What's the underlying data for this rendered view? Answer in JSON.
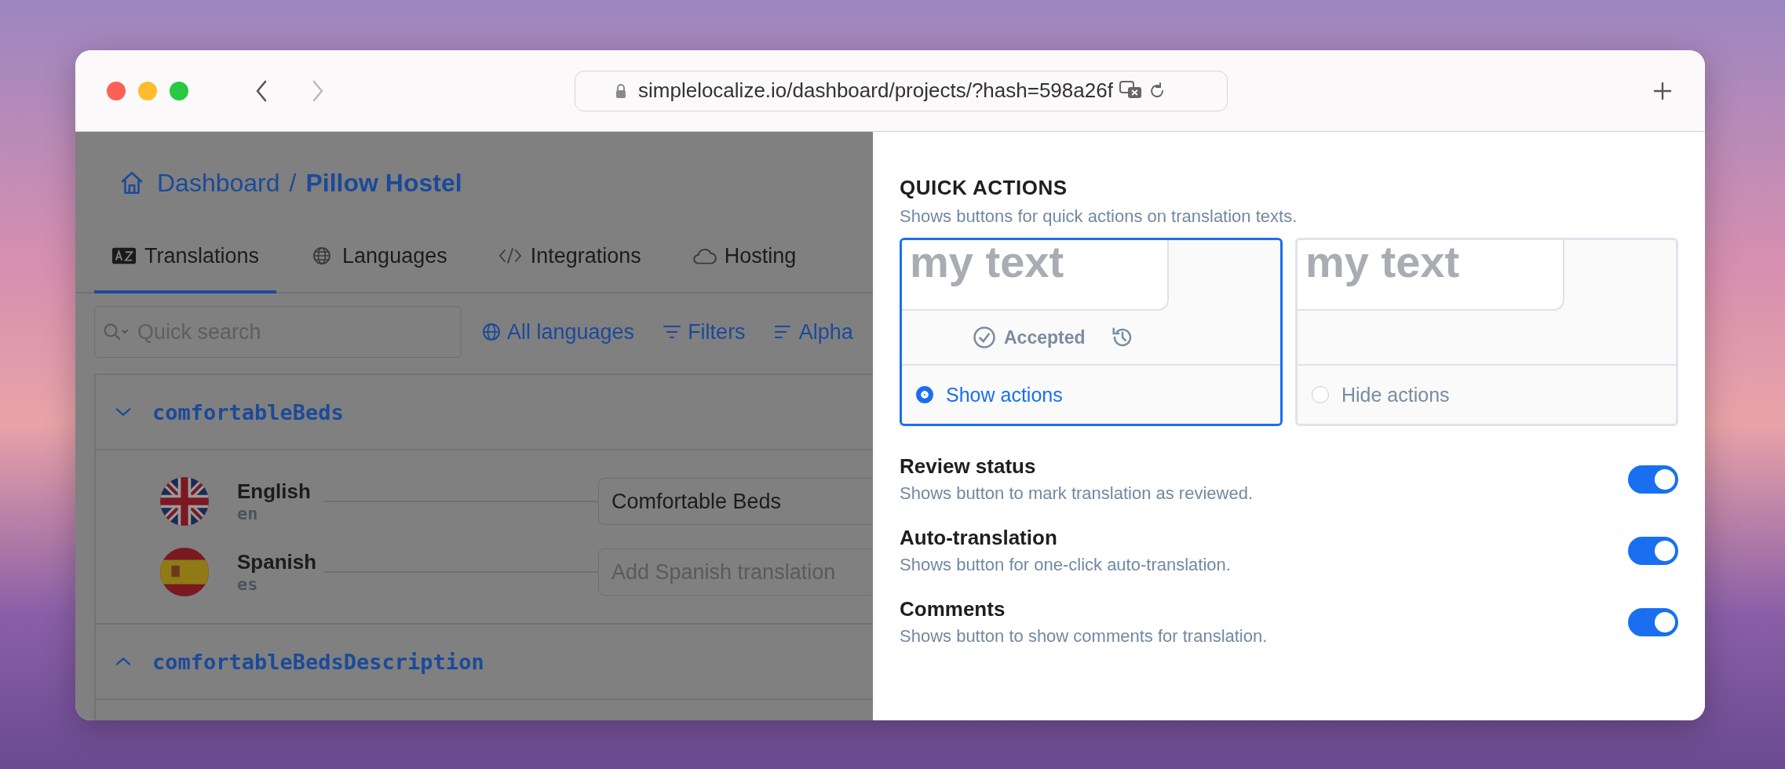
{
  "browser": {
    "url": "simplelocalize.io/dashboard/projects/?hash=598a26f"
  },
  "breadcrumb": {
    "parent": "Dashboard",
    "separator": "/",
    "current": "Pillow Hostel"
  },
  "tabs": [
    {
      "label": "Translations",
      "selected": true
    },
    {
      "label": "Languages",
      "selected": false
    },
    {
      "label": "Integrations",
      "selected": false
    },
    {
      "label": "Hosting",
      "selected": false
    }
  ],
  "search": {
    "placeholder": "Quick search"
  },
  "filters": [
    "All languages",
    "Filters",
    "Alpha"
  ],
  "keys": [
    {
      "key": "comfortableBeds",
      "expanded": true,
      "translations": [
        {
          "language": "English",
          "code": "en",
          "value": "Comfortable Beds"
        },
        {
          "language": "Spanish",
          "code": "es",
          "placeholder": "Add Spanish translation"
        }
      ]
    },
    {
      "key": "comfortableBedsDescription",
      "expanded": false
    }
  ],
  "quick_actions": {
    "title": "QUICK ACTIONS",
    "description": "Shows buttons for quick actions on translation texts.",
    "options": [
      {
        "preview_text": "my text",
        "status_label": "Accepted",
        "label": "Show actions",
        "selected": true
      },
      {
        "preview_text": "my text",
        "label": "Hide actions",
        "selected": false
      }
    ]
  },
  "settings": [
    {
      "title": "Review status",
      "description": "Shows button to mark translation as reviewed.",
      "on": true
    },
    {
      "title": "Auto-translation",
      "description": "Shows button for one-click auto-translation.",
      "on": true
    },
    {
      "title": "Comments",
      "description": "Shows button to show comments for translation.",
      "on": true
    }
  ]
}
